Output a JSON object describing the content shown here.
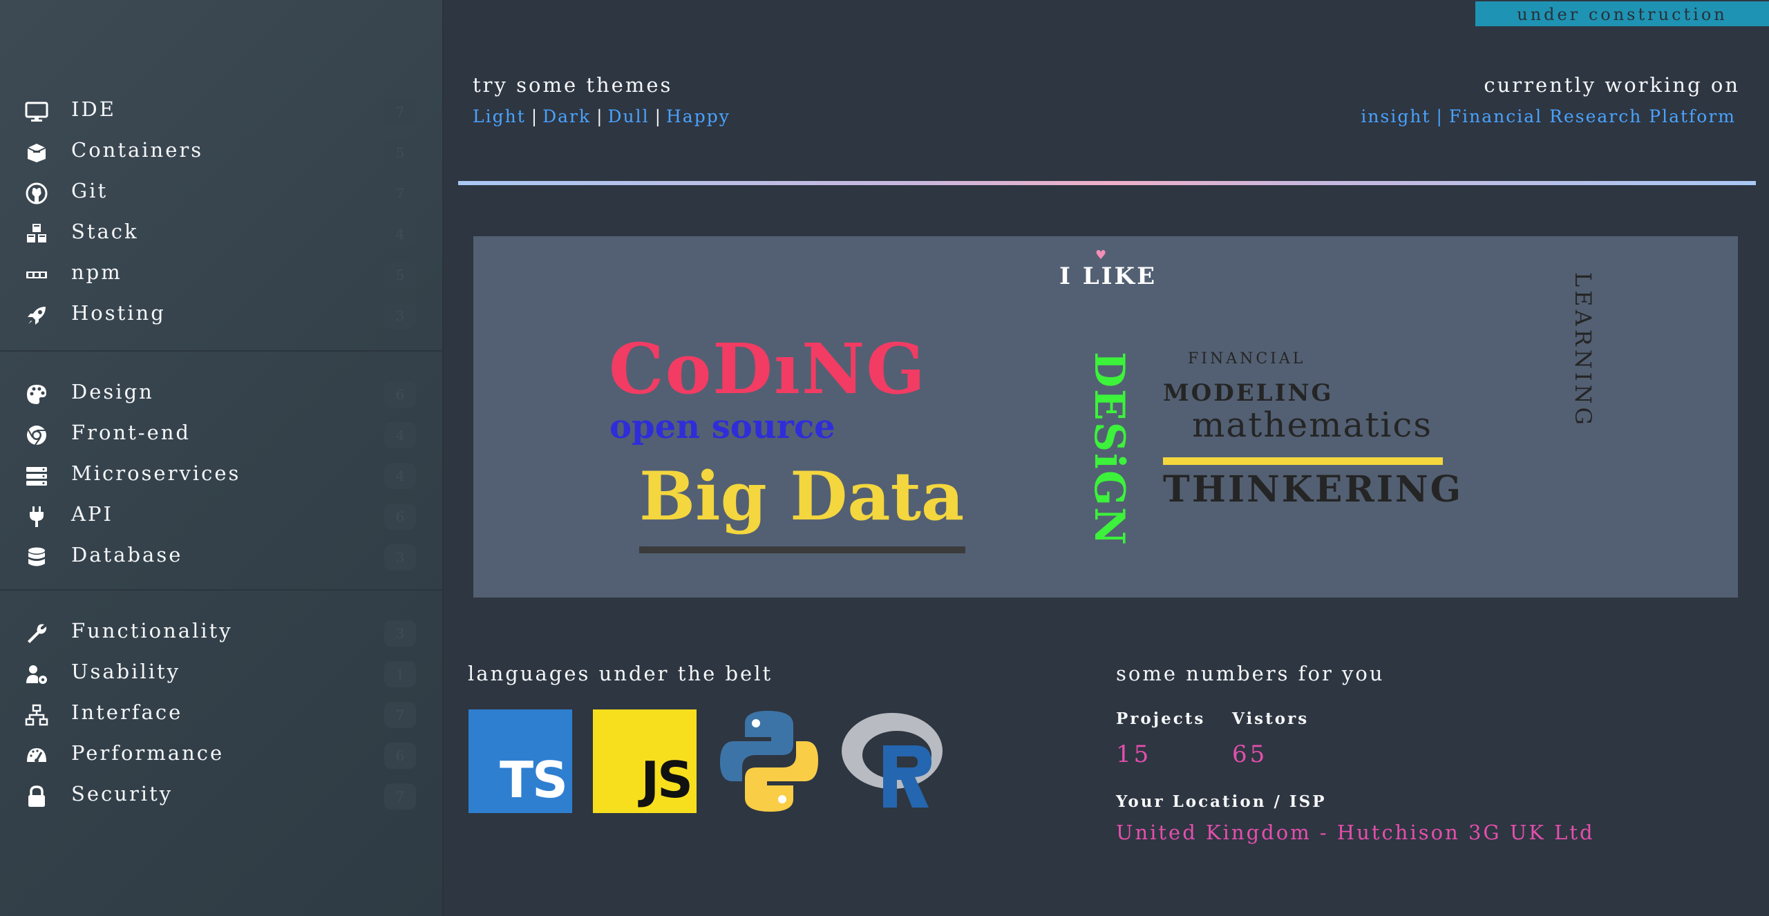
{
  "sidebar": {
    "groups": [
      {
        "items": [
          {
            "label": "IDE",
            "icon": "monitor-icon",
            "count": "7"
          },
          {
            "label": "Containers",
            "icon": "box-icon",
            "count": "5"
          },
          {
            "label": "Git",
            "icon": "github-icon",
            "count": "7"
          },
          {
            "label": "Stack",
            "icon": "cubes-icon",
            "count": "4"
          },
          {
            "label": "npm",
            "icon": "npm-icon",
            "count": "5"
          },
          {
            "label": "Hosting",
            "icon": "rocket-icon",
            "count": "3"
          }
        ]
      },
      {
        "items": [
          {
            "label": "Design",
            "icon": "palette-icon",
            "count": "6"
          },
          {
            "label": "Front-end",
            "icon": "chrome-icon",
            "count": "4"
          },
          {
            "label": "Microservices",
            "icon": "server-icon",
            "count": "4"
          },
          {
            "label": "API",
            "icon": "plug-icon",
            "count": "6"
          },
          {
            "label": "Database",
            "icon": "database-icon",
            "count": "3"
          }
        ]
      },
      {
        "items": [
          {
            "label": "Functionality",
            "icon": "wrench-icon",
            "count": "3"
          },
          {
            "label": "Usability",
            "icon": "user-gear-icon",
            "count": "1"
          },
          {
            "label": "Interface",
            "icon": "sitemap-icon",
            "count": "7"
          },
          {
            "label": "Performance",
            "icon": "gauge-icon",
            "count": "6"
          },
          {
            "label": "Security",
            "icon": "lock-icon",
            "count": "7"
          }
        ]
      }
    ]
  },
  "banner": {
    "construction": "under construction"
  },
  "themes": {
    "title": "try some themes",
    "options": [
      "Light",
      "Dark",
      "Dull",
      "Happy"
    ],
    "separator": "|"
  },
  "working": {
    "title": "currently working on",
    "project": "insight",
    "separator": "|",
    "description": "Financial Research Platform"
  },
  "cloud": {
    "heart": "♥",
    "heading": "I LIKE",
    "words": {
      "coding": "CoDıNG",
      "open_source": "open source",
      "big_data": "Big Data",
      "design": "DESiGN",
      "financial": "FINANCIAL",
      "modeling": "MODELING",
      "mathematics": "mathematics",
      "thinkering": "THINKERING",
      "learning": "LEARNING"
    },
    "colors": {
      "coding": "#f23c63",
      "open_source": "#2f2dd9",
      "big_data": "#f4d63e",
      "design": "#3cf23b",
      "dark_text": "#252525",
      "accent_bar": "#f4d63e",
      "heart": "#f48fb8"
    }
  },
  "languages": {
    "title": "languages under the belt",
    "logos": [
      {
        "name": "ts-logo",
        "text": "TS",
        "bg": "#2f7fd1"
      },
      {
        "name": "js-logo",
        "text": "JS",
        "bg": "#f7df1e"
      },
      {
        "name": "python-logo",
        "text": ""
      },
      {
        "name": "r-logo",
        "text": "R"
      }
    ]
  },
  "numbers": {
    "title": "some numbers for you",
    "projects_label": "Projects",
    "projects_value": "15",
    "visitors_label": "Vistors",
    "visitors_value": "65",
    "location_label": "Your Location / ISP",
    "location_value": "United Kingdom - Hutchison 3G UK Ltd"
  }
}
